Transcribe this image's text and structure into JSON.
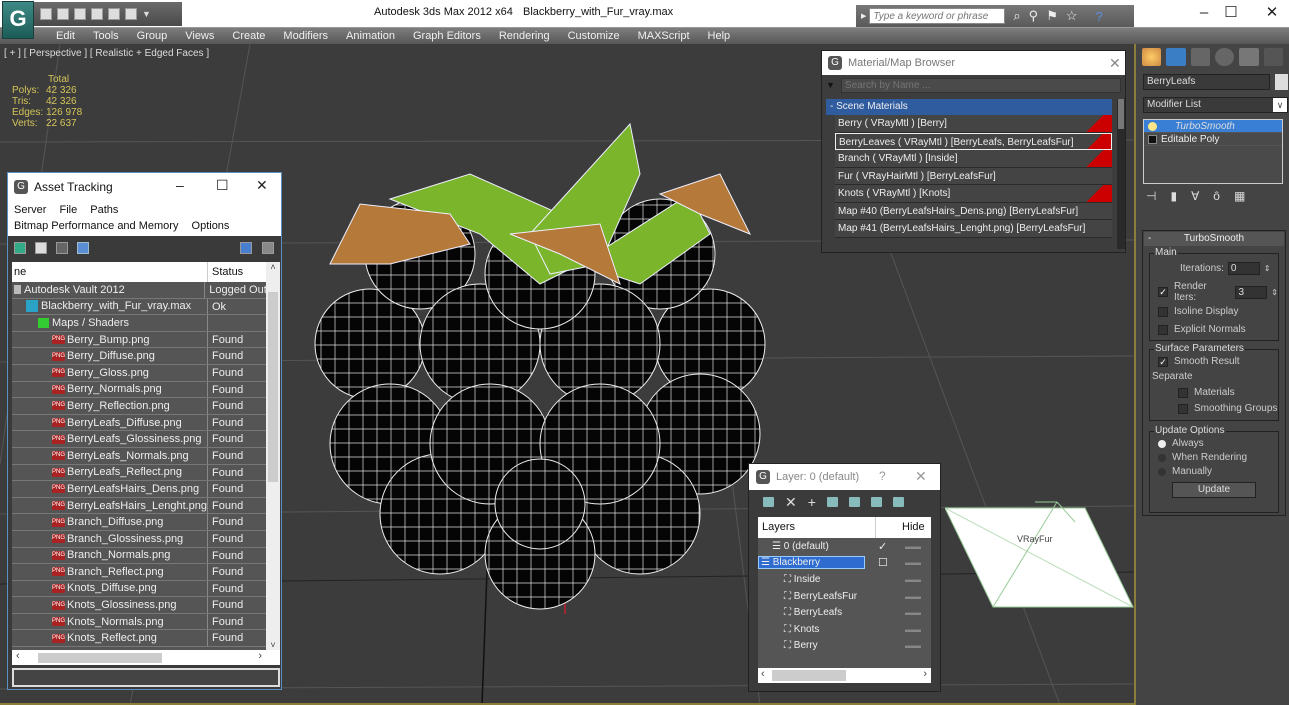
{
  "window": {
    "app_title": "Autodesk 3ds Max  2012 x64",
    "file_name": "Blackberry_with_Fur_vray.max",
    "search_placeholder": "Type a keyword or phrase",
    "minimize": "–",
    "maximize": "☐",
    "close": "✕"
  },
  "menubar": [
    "Edit",
    "Tools",
    "Group",
    "Views",
    "Create",
    "Modifiers",
    "Animation",
    "Graph Editors",
    "Rendering",
    "Customize",
    "MAXScript",
    "Help"
  ],
  "viewport": {
    "label": "[ + ] [ Perspective ] [ Realistic + Edged Faces ]",
    "stats_header": "Total",
    "stats": [
      {
        "label": "Polys:",
        "value": "42 326"
      },
      {
        "label": "Tris:",
        "value": "42 326"
      },
      {
        "label": "Edges:",
        "value": "126 978"
      },
      {
        "label": "Verts:",
        "value": "22 637"
      }
    ],
    "object_label": "VRayFur"
  },
  "asset_tracking": {
    "title": "Asset Tracking",
    "menu": [
      "Server",
      "File",
      "Paths",
      "Bitmap Performance and Memory",
      "Options"
    ],
    "columns": [
      "ne",
      "Status"
    ],
    "rows": [
      {
        "name": "Autodesk Vault 2012",
        "status": "Logged Out",
        "type": "vault",
        "indent": 0
      },
      {
        "name": "Blackberry_with_Fur_vray.max",
        "status": "Ok",
        "type": "max",
        "indent": 1
      },
      {
        "name": "Maps / Shaders",
        "status": "",
        "type": "maps",
        "indent": 2
      },
      {
        "name": "Berry_Bump.png",
        "status": "Found",
        "type": "png",
        "indent": 3
      },
      {
        "name": "Berry_Diffuse.png",
        "status": "Found",
        "type": "png",
        "indent": 3
      },
      {
        "name": "Berry_Gloss.png",
        "status": "Found",
        "type": "png",
        "indent": 3
      },
      {
        "name": "Berry_Normals.png",
        "status": "Found",
        "type": "png",
        "indent": 3
      },
      {
        "name": "Berry_Reflection.png",
        "status": "Found",
        "type": "png",
        "indent": 3
      },
      {
        "name": "BerryLeafs_Diffuse.png",
        "status": "Found",
        "type": "png",
        "indent": 3
      },
      {
        "name": "BerryLeafs_Glossiness.png",
        "status": "Found",
        "type": "png",
        "indent": 3
      },
      {
        "name": "BerryLeafs_Normals.png",
        "status": "Found",
        "type": "png",
        "indent": 3
      },
      {
        "name": "BerryLeafs_Reflect.png",
        "status": "Found",
        "type": "png",
        "indent": 3
      },
      {
        "name": "BerryLeafsHairs_Dens.png",
        "status": "Found",
        "type": "png",
        "indent": 3
      },
      {
        "name": "BerryLeafsHairs_Lenght.png",
        "status": "Found",
        "type": "png",
        "indent": 3
      },
      {
        "name": "Branch_Diffuse.png",
        "status": "Found",
        "type": "png",
        "indent": 3
      },
      {
        "name": "Branch_Glossiness.png",
        "status": "Found",
        "type": "png",
        "indent": 3
      },
      {
        "name": "Branch_Normals.png",
        "status": "Found",
        "type": "png",
        "indent": 3
      },
      {
        "name": "Branch_Reflect.png",
        "status": "Found",
        "type": "png",
        "indent": 3
      },
      {
        "name": "Knots_Diffuse.png",
        "status": "Found",
        "type": "png",
        "indent": 3
      },
      {
        "name": "Knots_Glossiness.png",
        "status": "Found",
        "type": "png",
        "indent": 3
      },
      {
        "name": "Knots_Normals.png",
        "status": "Found",
        "type": "png",
        "indent": 3
      },
      {
        "name": "Knots_Reflect.png",
        "status": "Found",
        "type": "png",
        "indent": 3
      }
    ]
  },
  "material_browser": {
    "title": "Material/Map Browser",
    "search_placeholder": "Search by Name ...",
    "group": "- Scene Materials",
    "items": [
      {
        "label": "Berry  ( VRayMtl ) [Berry]",
        "red": true,
        "selected": false
      },
      {
        "label": "BerryLeaves  ( VRayMtl ) [BerryLeafs, BerryLeafsFur]",
        "red": true,
        "selected": true
      },
      {
        "label": "Branch  ( VRayMtl ) [Inside]",
        "red": true,
        "selected": false
      },
      {
        "label": "Fur  ( VRayHairMtl ) [BerryLeafsFur]",
        "red": false,
        "selected": false
      },
      {
        "label": "Knots  ( VRayMtl ) [Knots]",
        "red": true,
        "selected": false
      },
      {
        "label": "Map #40 (BerryLeafsHairs_Dens.png) [BerryLeafsFur]",
        "red": false,
        "selected": false
      },
      {
        "label": "Map #41 (BerryLeafsHairs_Lenght.png) [BerryLeafsFur]",
        "red": false,
        "selected": false
      }
    ]
  },
  "layer_dialog": {
    "title": "Layer: 0 (default)",
    "help": "?",
    "columns": [
      "Layers",
      "Hide"
    ],
    "rows": [
      {
        "name": "0 (default)",
        "indent": 1,
        "check": "✓",
        "selected": false
      },
      {
        "name": "Blackberry",
        "indent": 0,
        "check": "☐",
        "selected": true
      },
      {
        "name": "Inside",
        "indent": 2,
        "check": "",
        "selected": false
      },
      {
        "name": "BerryLeafsFur",
        "indent": 2,
        "check": "",
        "selected": false
      },
      {
        "name": "BerryLeafs",
        "indent": 2,
        "check": "",
        "selected": false
      },
      {
        "name": "Knots",
        "indent": 2,
        "check": "",
        "selected": false
      },
      {
        "name": "Berry",
        "indent": 2,
        "check": "",
        "selected": false
      }
    ]
  },
  "command_panel": {
    "object_name": "BerryLeafs",
    "modifier_list": "Modifier List",
    "stack": [
      {
        "label": "TurboSmooth",
        "selected": true
      },
      {
        "label": "Editable Poly",
        "selected": false
      }
    ],
    "rollout_title": "TurboSmooth",
    "main_group": "Main",
    "iterations_label": "Iterations:",
    "iterations_value": "0",
    "render_iters_label": "Render Iters:",
    "render_iters_value": "3",
    "render_iters_checked": true,
    "isoline_label": "Isoline Display",
    "explicit_normals_label": "Explicit Normals",
    "surface_group": "Surface Parameters",
    "smooth_result_label": "Smooth Result",
    "separate_label": "Separate",
    "materials_label": "Materials",
    "smoothing_groups_label": "Smoothing Groups",
    "update_group": "Update Options",
    "update_options": [
      {
        "label": "Always",
        "selected": true
      },
      {
        "label": "When Rendering",
        "selected": false
      },
      {
        "label": "Manually",
        "selected": false
      }
    ],
    "update_button": "Update"
  }
}
